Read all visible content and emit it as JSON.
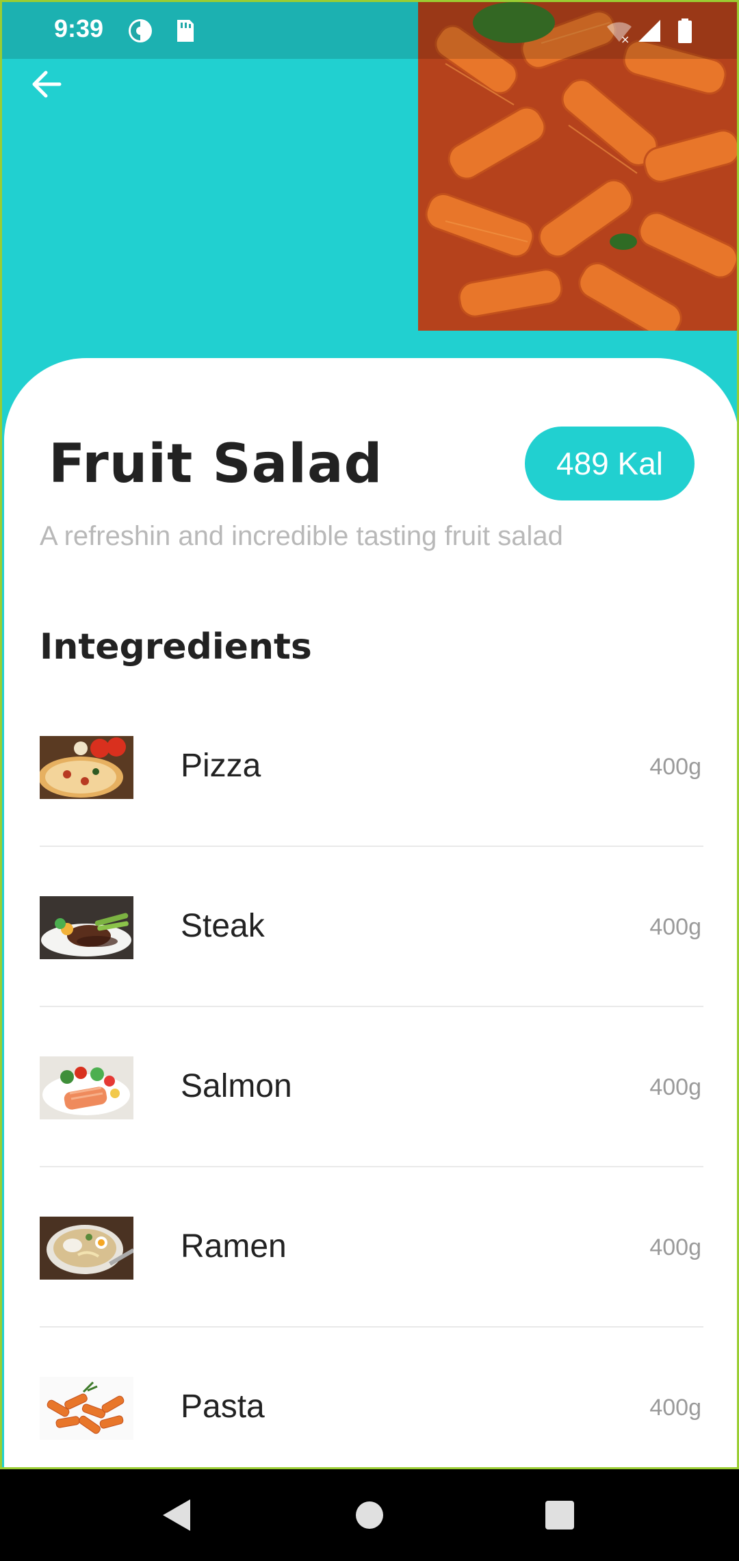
{
  "status_bar": {
    "time": "9:39",
    "icons": [
      "vpn-icon",
      "sd-card-icon",
      "wifi-off-icon",
      "signal-icon",
      "battery-icon"
    ]
  },
  "header": {
    "back_icon": "arrow-left-icon",
    "hero_image": "pasta-photo"
  },
  "recipe": {
    "title": "Fruit Salad",
    "calories": "489 Kal",
    "description": "A refreshin and incredible tasting fruit salad"
  },
  "ingredients": {
    "heading": "Integredients",
    "items": [
      {
        "name": "Pizza",
        "amount": "400g",
        "image": "pizza-photo"
      },
      {
        "name": "Steak",
        "amount": "400g",
        "image": "steak-photo"
      },
      {
        "name": "Salmon",
        "amount": "400g",
        "image": "salmon-photo"
      },
      {
        "name": "Ramen",
        "amount": "400g",
        "image": "ramen-photo"
      },
      {
        "name": "Pasta",
        "amount": "400g",
        "image": "pasta-photo"
      }
    ]
  },
  "colors": {
    "accent": "#21D0D0",
    "title_text": "#222222",
    "muted_text": "#B8B8B8",
    "divider": "#E9E9E9"
  },
  "nav_bar": {
    "icons": [
      "back-triangle-icon",
      "home-circle-icon",
      "recents-square-icon"
    ]
  }
}
